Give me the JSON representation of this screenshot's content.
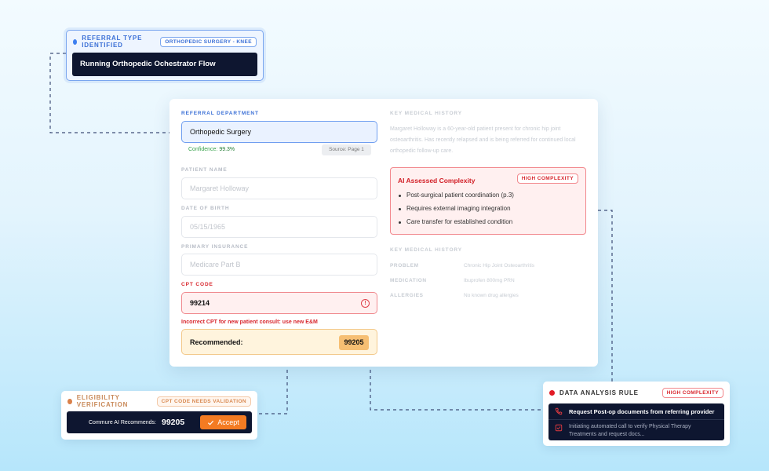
{
  "referral_card": {
    "label": "REFERRAL TYPE IDENTIFIED",
    "badge": "ORTHOPEDIC SURGERY - KNEE",
    "status": "Running Orthopedic Ochestrator Flow"
  },
  "form": {
    "referral_department": {
      "label": "REFERRAL DEPARTMENT",
      "value": "Orthopedic Surgery",
      "confidence_label": "Confidence:",
      "confidence_value": "99.3%",
      "source": "Source: Page 1"
    },
    "patient_name": {
      "label": "PATIENT NAME",
      "value": "Margaret Holloway"
    },
    "date_of_birth": {
      "label": "DATE OF BIRTH",
      "value": "05/15/1965"
    },
    "primary_insurance": {
      "label": "PRIMARY INSURANCE",
      "value": "Medicare Part B"
    },
    "cpt_code": {
      "label": "CPT CODE",
      "value": "99214",
      "error": "Incorrect CPT for new patient consult: use new E&M",
      "recommended_label": "Recommended:",
      "recommended_value": "99205"
    }
  },
  "medical_history": {
    "label": "KEY MEDICAL HISTORY",
    "text": "Margaret Holloway is a 60-year-old patient present for chronic hip joint osteoarthritis. Has recently relapsed and is being referred for continued local orthopedic follow-up care."
  },
  "complexity": {
    "title": "AI Assessed Complexity",
    "badge": "HIGH COMPLEXITY",
    "items": [
      "Post-surgical patient coordination (p.3)",
      "Requires external imaging integration",
      "Care transfer for established condition"
    ]
  },
  "medical_history_table": {
    "label": "KEY MEDICAL HISTORY",
    "rows": [
      {
        "key": "PROBLEM",
        "value": "Chronic Hip Joint Osteoarthritis"
      },
      {
        "key": "MEDICATION",
        "value": "Ibuprofen 800mg PRN"
      },
      {
        "key": "ALLERGIES",
        "value": "No known drug allergies"
      }
    ]
  },
  "eligibility_card": {
    "label": "ELIGIBILITY VERIFICATION",
    "badge": "CPT CODE NEEDS VALIDATION",
    "rec_label": "Commure AI Recommends:",
    "rec_value": "99205",
    "accept_label": "Accept"
  },
  "data_rule_card": {
    "label": "DATA ANALYSIS RULE",
    "badge": "HIGH COMPLEXITY",
    "item1": "Request Post-op documents from referring provider",
    "item2": "Initiating automated call to verify Physical Therapy Treatments and request docs..."
  },
  "colors": {
    "accent_blue": "#3d7ff0",
    "alert_red": "#d8272e",
    "orange": "#f47b22",
    "dark": "#0e1630"
  },
  "icons": [
    "check-icon",
    "phone-icon",
    "checkbox-icon",
    "alert-circle-icon"
  ]
}
